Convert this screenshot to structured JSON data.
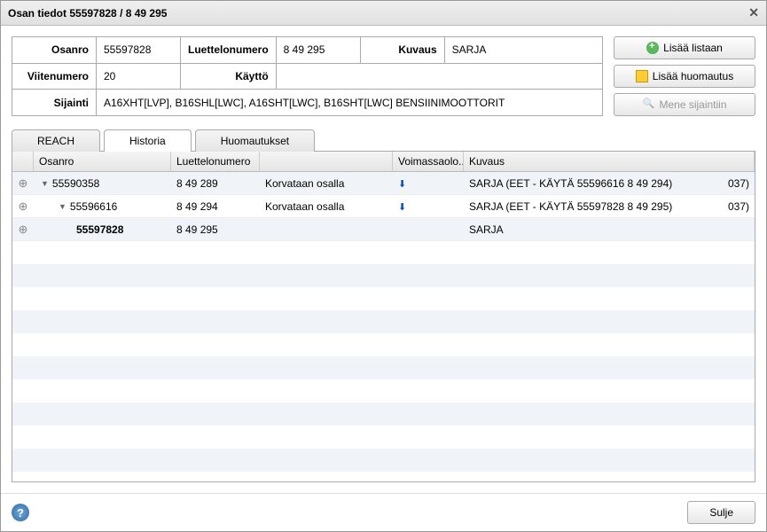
{
  "title": "Osan tiedot 55597828 / 8 49 295",
  "info": {
    "osanro_label": "Osanro",
    "osanro": "55597828",
    "luettelo_label": "Luettelonumero",
    "luettelo": "8 49 295",
    "kuvaus_label": "Kuvaus",
    "kuvaus": "SARJA",
    "viite_label": "Viitenumero",
    "viite": "20",
    "kaytto_label": "Käyttö",
    "kaytto": "",
    "sijainti_label": "Sijainti",
    "sijainti": "A16XHT[LVP], B16SHL[LWC], A16SHT[LWC], B16SHT[LWC] BENSIINIMOOTTORIT"
  },
  "buttons": {
    "lisaa_listaan": "Lisää listaan",
    "lisaa_huomautus": "Lisää huomautus",
    "mene_sijaintiin": "Mene sijaintiin",
    "sulje": "Sulje"
  },
  "tabs": {
    "reach": "REACH",
    "historia": "Historia",
    "huomautukset": "Huomautukset"
  },
  "grid": {
    "headers": {
      "osanro": "Osanro",
      "luettelo": "Luettelonumero",
      "voimassaolo": "Voimassaolo...",
      "kuvaus": "Kuvaus"
    },
    "rows": [
      {
        "osanro": "55590358",
        "luettelo": "8 49 289",
        "action": "Korvataan osalla",
        "kuvaus": "SARJA (EET - KÄYTÄ 55596616  8 49 294)",
        "end": "037)"
      },
      {
        "osanro": "55596616",
        "luettelo": "8 49 294",
        "action": "Korvataan osalla",
        "kuvaus": "SARJA (EET - KÄYTÄ 55597828  8 49 295)",
        "end": "037)"
      },
      {
        "osanro": "55597828",
        "luettelo": "8 49 295",
        "action": "",
        "kuvaus": "SARJA",
        "end": ""
      }
    ]
  }
}
